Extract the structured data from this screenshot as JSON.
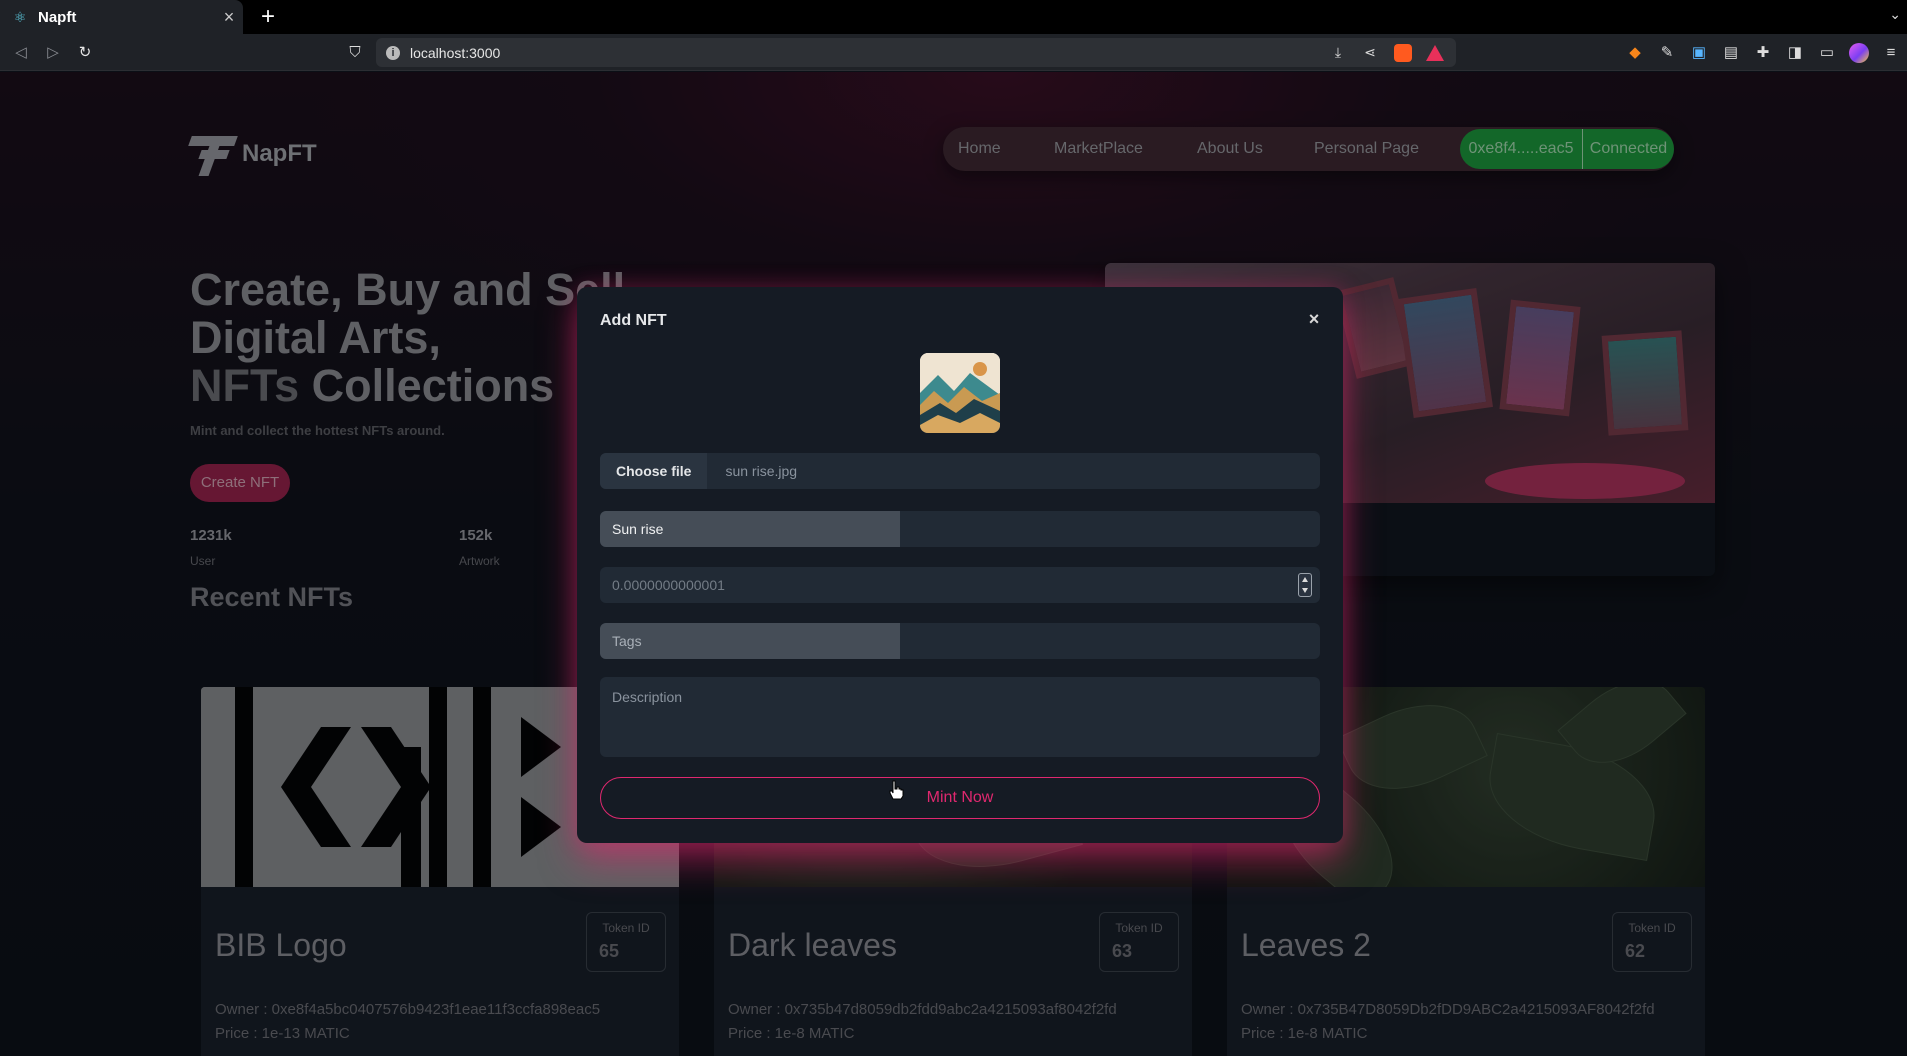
{
  "browser": {
    "tab_title": "Napft",
    "new_tab": "+",
    "tab_close": "×",
    "url": "localhost:3000"
  },
  "nav": {
    "brand": "NapFT",
    "links": [
      "Home",
      "MarketPlace",
      "About Us",
      "Personal Page"
    ],
    "wallet_address": "0xe8f4.....eac5",
    "wallet_status": "Connected",
    "status_color": "#1b9a3a"
  },
  "hero": {
    "title_line1": "Create, Buy and Sell",
    "title_line2": "Digital Arts,",
    "title_line3_dim": "NFTs",
    "title_line3": " Collections",
    "subtitle": "Mint and collect the hottest NFTs around.",
    "cta": "Create NFT",
    "stats": [
      {
        "value": "1231k",
        "label": "User"
      },
      {
        "value": "152k",
        "label": "Artwork"
      }
    ]
  },
  "recent": {
    "title": "Recent NFTs",
    "token_label": "Token ID",
    "cards": [
      {
        "name": "BIB Logo",
        "token_id": "65",
        "owner": "Owner : 0xe8f4a5bc0407576b9423f1eae11f3ccfa898eac5",
        "price": "Price : 1e-13 MATIC"
      },
      {
        "name": "Dark leaves",
        "token_id": "63",
        "owner": "Owner : 0x735b47d8059db2fdd9abc2a4215093af8042f2fd",
        "price": "Price : 1e-8 MATIC"
      },
      {
        "name": "Leaves 2",
        "token_id": "62",
        "owner": "Owner : 0x735B47D8059Db2fDD9ABC2a4215093AF8042f2fd",
        "price": "Price : 1e-8 MATIC"
      }
    ]
  },
  "modal": {
    "title": "Add NFT",
    "close": "×",
    "file_button": "Choose file",
    "file_name": "sun rise.jpg",
    "name_value": "Sun rise",
    "price_value": "0.0000000000001",
    "tags_placeholder": "Tags",
    "description_placeholder": "Description",
    "submit": "Mint Now",
    "accent_color": "#e0286f"
  }
}
